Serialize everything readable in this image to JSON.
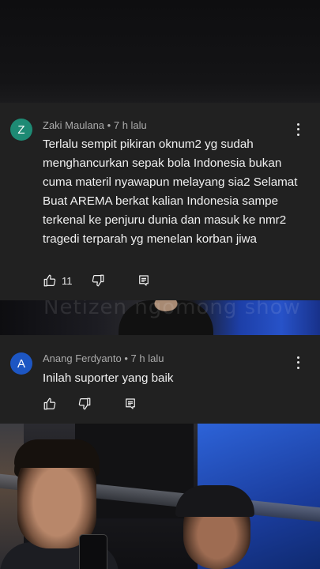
{
  "comments": [
    {
      "avatar_letter": "Z",
      "avatar_color": "#1e8a74",
      "author": "Zaki Maulana",
      "time": "7 h lalu",
      "text": "Terlalu sempit pikiran oknum2 yg sudah menghancurkan sepak bola Indonesia bukan cuma materil nyawapun melayang sia2 Selamat Buat AREMA berkat kalian Indonesia sampe terkenal ke penjuru dunia dan masuk ke nmr2 tragedi terparah yg menelan korban jiwa",
      "likes": "11"
    },
    {
      "avatar_letter": "A",
      "avatar_color": "#1d56c3",
      "author": "Anang Ferdyanto",
      "time": "7 h lalu",
      "text": "Inilah suporter yang baik",
      "likes": ""
    }
  ],
  "separator": "•",
  "background": {
    "watermark": "Netizen ngomong show"
  },
  "icons": {
    "like": "thumb-up-icon",
    "dislike": "thumb-down-icon",
    "reply": "reply-icon",
    "menu": "more-vert-icon"
  }
}
